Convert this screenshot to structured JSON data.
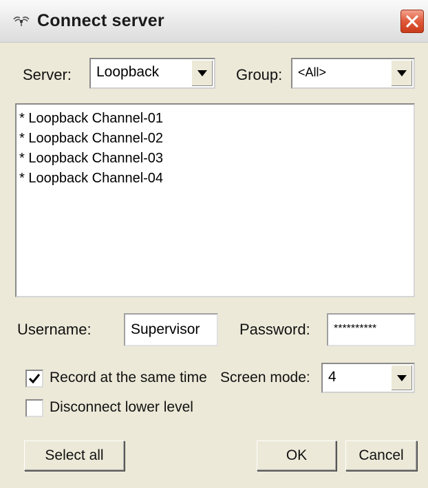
{
  "window": {
    "title": "Connect server"
  },
  "server": {
    "label": "Server:",
    "value": "Loopback"
  },
  "group": {
    "label": "Group:",
    "value": "<All>"
  },
  "channels": [
    "* Loopback Channel-01",
    "* Loopback Channel-02",
    "* Loopback Channel-03",
    "* Loopback Channel-04"
  ],
  "credentials": {
    "username_label": "Username:",
    "username_value": "Supervisor",
    "password_label": "Password:",
    "password_value": "**********"
  },
  "options": {
    "record_label": "Record at the same time",
    "record_checked": true,
    "disconnect_label": "Disconnect lower level",
    "disconnect_checked": false,
    "screen_mode_label": "Screen mode:",
    "screen_mode_value": "4"
  },
  "buttons": {
    "select_all": "Select all",
    "ok": "OK",
    "cancel": "Cancel"
  },
  "colors": {
    "dialog_background": "#ece9d8",
    "close_button": "#e0593a"
  },
  "icons": {
    "title": "satellite-signal-icon",
    "close": "close-icon",
    "dropdown": "chevron-down-icon",
    "check": "checkmark-icon"
  }
}
